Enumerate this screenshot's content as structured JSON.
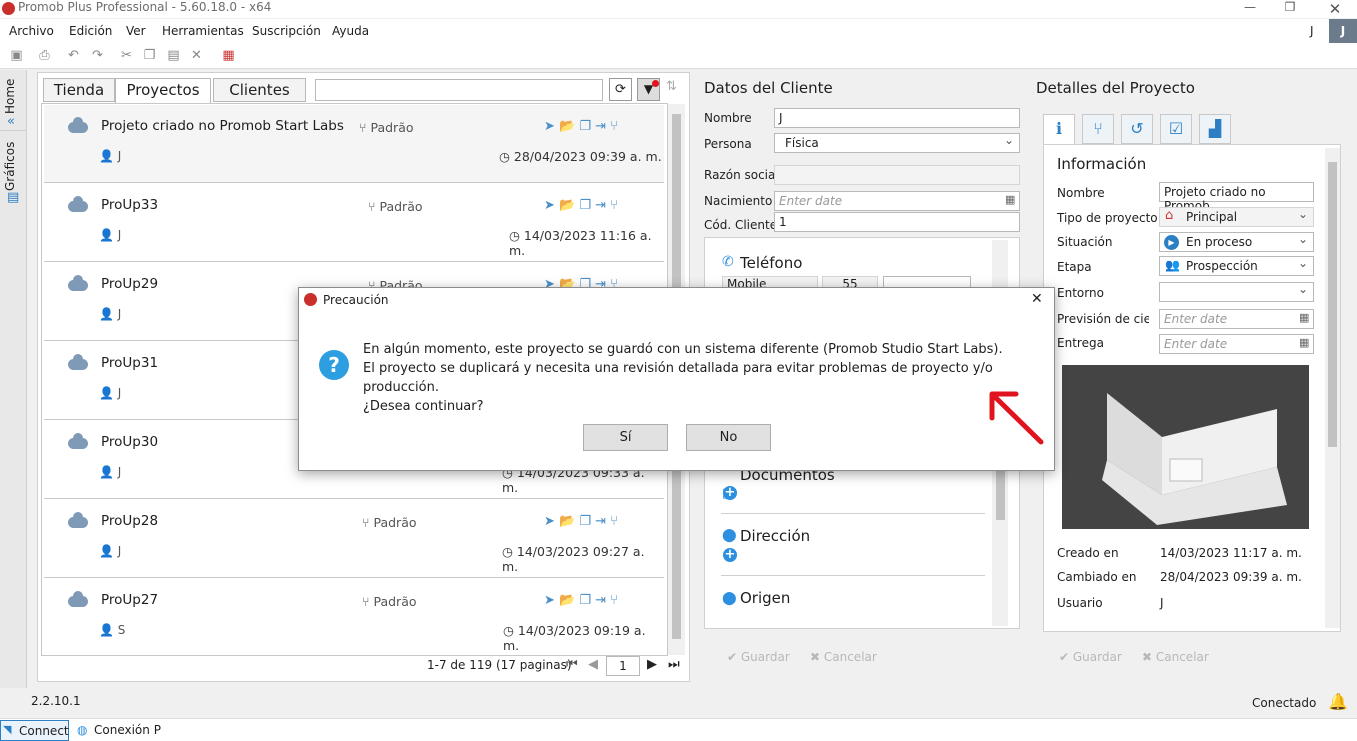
{
  "window": {
    "title": "Promob Plus Professional - 5.60.18.0 - x64"
  },
  "menu": [
    "Archivo",
    "Edición",
    "Ver",
    "Herramientas",
    "Suscripción",
    "Ayuda"
  ],
  "user_initial": "J",
  "user_badge": "J",
  "sidebar": {
    "home": "Home",
    "graphics": "Gráficos"
  },
  "tabs": [
    "Tienda",
    "Proyectos",
    "Clientes"
  ],
  "projects": [
    {
      "name": "Projeto criado no Promob Start Labs",
      "type": "Padrão",
      "user": "J",
      "date": "28/04/2023 09:39 a. m."
    },
    {
      "name": "ProUp33",
      "type": "Padrão",
      "user": "J",
      "date": "14/03/2023 11:16 a. m."
    },
    {
      "name": "ProUp29",
      "type": "Padrão",
      "user": "J",
      "date": ""
    },
    {
      "name": "ProUp31",
      "type": "",
      "user": "J",
      "date": ""
    },
    {
      "name": "ProUp30",
      "type": "",
      "user": "J",
      "date": "14/03/2023 09:33 a. m."
    },
    {
      "name": "ProUp28",
      "type": "Padrão",
      "user": "J",
      "date": "14/03/2023 09:27 a. m."
    },
    {
      "name": "ProUp27",
      "type": "Padrão",
      "user": "S",
      "date": "14/03/2023 09:19 a. m."
    }
  ],
  "pagination": {
    "summary": "1-7 de 119 (17 paginas)",
    "page": "1"
  },
  "client": {
    "title": "Datos del Cliente",
    "labels": {
      "name": "Nombre",
      "person": "Persona",
      "business": "Razón social",
      "birth": "Nacimiento",
      "code": "Cód. Cliente"
    },
    "values": {
      "name": "J",
      "person": "Física",
      "business": "",
      "birth_placeholder": "Enter date",
      "code": "1"
    },
    "sections": {
      "phone": "Teléfono",
      "documents": "Documentos",
      "address": "Dirección",
      "origin": "Origen"
    },
    "phone": {
      "type": "Mobile",
      "area": "55"
    },
    "save": "Guardar",
    "cancel": "Cancelar"
  },
  "details": {
    "title": "Detalles del Proyecto",
    "section": "Información",
    "labels": {
      "name": "Nombre",
      "type": "Tipo de proyecto",
      "status": "Situación",
      "stage": "Etapa",
      "environment": "Entorno",
      "forecast": "Previsión de cierre",
      "delivery": "Entrega",
      "created": "Creado en",
      "changed": "Cambiado en",
      "user": "Usuario"
    },
    "values": {
      "name": "Projeto criado no Promob",
      "type": "Principal",
      "status": "En proceso",
      "stage": "Prospección",
      "environment": "",
      "forecast_placeholder": "Enter date",
      "delivery_placeholder": "Enter date",
      "created": "14/03/2023 11:17 a. m.",
      "changed": "28/04/2023 09:39 a. m.",
      "user": "J"
    },
    "save": "Guardar",
    "cancel": "Cancelar"
  },
  "status": {
    "version": "2.2.10.1",
    "connection": "Conectado"
  },
  "bottom_tabs": [
    "Connect",
    "Conexión P"
  ],
  "dialog": {
    "title": "Precaución",
    "line1": "En algún momento, este proyecto se guardó con un sistema diferente (Promob Studio Start Labs).",
    "line2": "El proyecto se duplicará y necesita una revisión detallada para evitar problemas de proyecto y/o producción.",
    "line3": "¿Desea continuar?",
    "yes": "Sí",
    "no": "No"
  },
  "colors": {
    "accent": "#2d8fdf",
    "dialog_icon": "#2d9ee0",
    "arrow": "#e0141e"
  }
}
